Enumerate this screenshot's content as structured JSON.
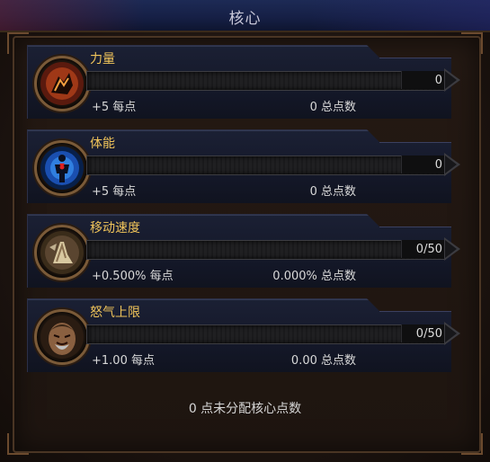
{
  "title": "核心",
  "stats": [
    {
      "name": "力量",
      "bar_value": "0",
      "per_point": "+5 每点",
      "total": "0 总点数",
      "icon": "strength-icon"
    },
    {
      "name": "体能",
      "bar_value": "0",
      "per_point": "+5 每点",
      "total": "0 总点数",
      "icon": "vitality-icon"
    },
    {
      "name": "移动速度",
      "bar_value": "0/50",
      "per_point": "+0.500% 每点",
      "total": "0.000% 总点数",
      "icon": "movement-speed-icon"
    },
    {
      "name": "怒气上限",
      "bar_value": "0/50",
      "per_point": "+1.00 每点",
      "total": "0.00 总点数",
      "icon": "max-fury-icon"
    }
  ],
  "unspent": "0 点未分配核心点数",
  "colors": {
    "accent": "#f0c45a",
    "title_bar": "#1d2a55",
    "frame": "#4a3524"
  }
}
